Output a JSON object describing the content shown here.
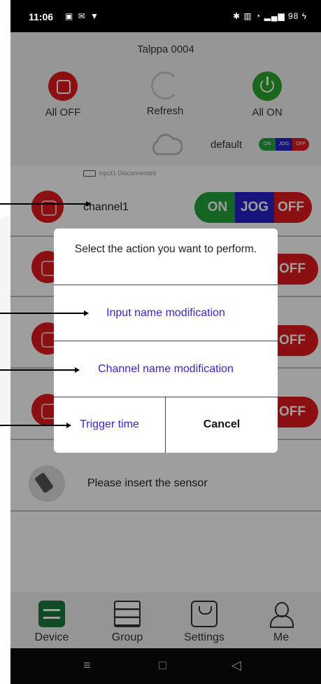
{
  "statusbar": {
    "time": "11:06",
    "left_icons": "▣ ✉ ▼",
    "right_icons": "✱ ▥ ◔ ▂▄▆ 98 ϟ"
  },
  "header": {
    "title": "Talppa 0004",
    "all_off": "All OFF",
    "refresh": "Refresh",
    "all_on": "All ON",
    "default_label": "default",
    "mini_switch": {
      "on": "ON",
      "jog": "JOG",
      "off": "OFF"
    }
  },
  "list": {
    "input_indicator": "Input1 Disconnected",
    "channel1": {
      "name": "channel1",
      "on": "ON",
      "jog": "JOG",
      "off": "OFF"
    },
    "off_label": "OFF",
    "sensor_text": "Please insert the sensor"
  },
  "dialog": {
    "message": "Select the action you want to perform.",
    "option_input_name": "Input name modification",
    "option_channel_name": "Channel name modification",
    "trigger_time": "Trigger time",
    "cancel": "Cancel"
  },
  "bottomnav": {
    "device": "Device",
    "group": "Group",
    "settings": "Settings",
    "me": "Me"
  },
  "sysnav": {
    "menu": "≡",
    "home": "□",
    "back": "◁"
  },
  "colors": {
    "red": "#e31a1c",
    "green": "#22a33a",
    "blue": "#2323c8",
    "link_blue": "#3b22d6",
    "nav_green": "#1b7a3c"
  }
}
